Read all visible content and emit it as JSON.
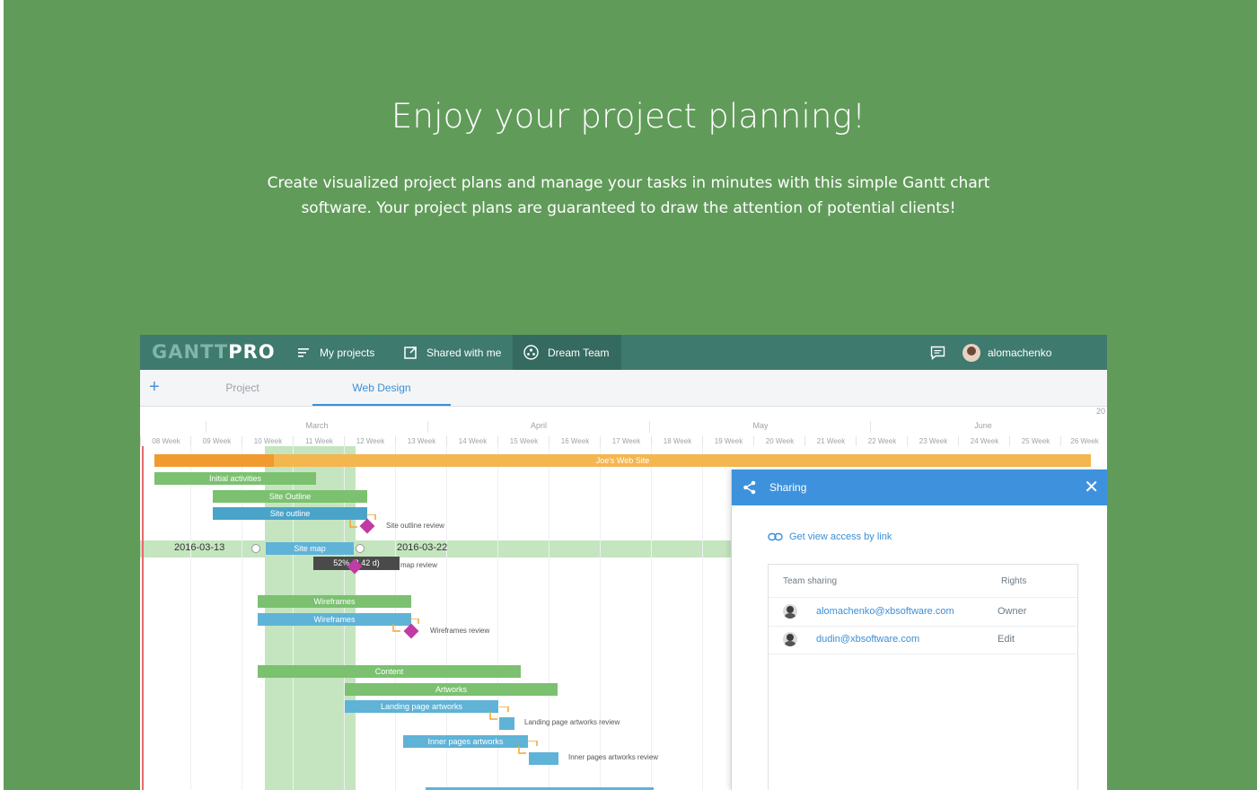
{
  "hero": {
    "title": "Enjoy your project planning!",
    "subtitle_line1": "Create visualized project plans and manage your tasks in minutes with this simple Gantt chart",
    "subtitle_line2": "software. Your project plans are guaranteed to draw the attention of potential clients!"
  },
  "app": {
    "logo_part1": "GANTT",
    "logo_part2": "PRO",
    "nav": {
      "my_projects": "My projects",
      "shared_with_me": "Shared with me",
      "dream_team": "Dream Team",
      "username": "alomachenko"
    },
    "tabs": {
      "add": "+",
      "project": "Project",
      "web_design": "Web Design"
    },
    "timeline": {
      "year_partial": "20",
      "months": [
        "March",
        "April",
        "May",
        "June"
      ],
      "weeks": [
        "08 Week",
        "09 Week",
        "10 Week",
        "11 Week",
        "12 Week",
        "13 Week",
        "14 Week",
        "15 Week",
        "16 Week",
        "17 Week",
        "18 Week",
        "19 Week",
        "20 Week",
        "21 Week",
        "22 Week",
        "23 Week",
        "24 Week",
        "25 Week",
        "26 Week"
      ]
    },
    "tasks": {
      "joes_web_site": "Joe's Web Site",
      "initial_activities": "Initial activities",
      "site_outline_1": "Site Outline",
      "site_outline_2": "Site outline",
      "site_outline_review": "Site outline review",
      "site_map": "Site map",
      "start_date": "2016-03-13",
      "end_date": "2016-03-22",
      "tooltip": "52% (3.42 d)",
      "map_review": "map review",
      "wireframes_1": "Wireframes",
      "wireframes_2": "Wireframes",
      "wireframes_review": "Wireframes review",
      "content": "Content",
      "artworks": "Artworks",
      "landing_page_artworks": "Landing page artworks",
      "landing_page_artworks_review": "Landing page artworks review",
      "inner_pages_artworks": "Inner pages artworks",
      "inner_pages_artworks_review": "Inner pages artworks review"
    },
    "sharing": {
      "title": "Sharing",
      "close": "✕",
      "view_link": "Get view access by link",
      "col_team": "Team sharing",
      "col_rights": "Rights",
      "members": [
        {
          "email": "alomachenko@xbsoftware.com",
          "rights": "Owner"
        },
        {
          "email": "dudin@xbsoftware.com",
          "rights": "Edit"
        }
      ]
    }
  },
  "colors": {
    "background": "#619b5a",
    "topbar": "#3e7a6e",
    "accent_blue": "#3e92dd",
    "task_green": "#7bc170",
    "task_blue": "#5fb3d6",
    "milestone": "#c13aa5",
    "project_orange": "#f4b64f"
  }
}
